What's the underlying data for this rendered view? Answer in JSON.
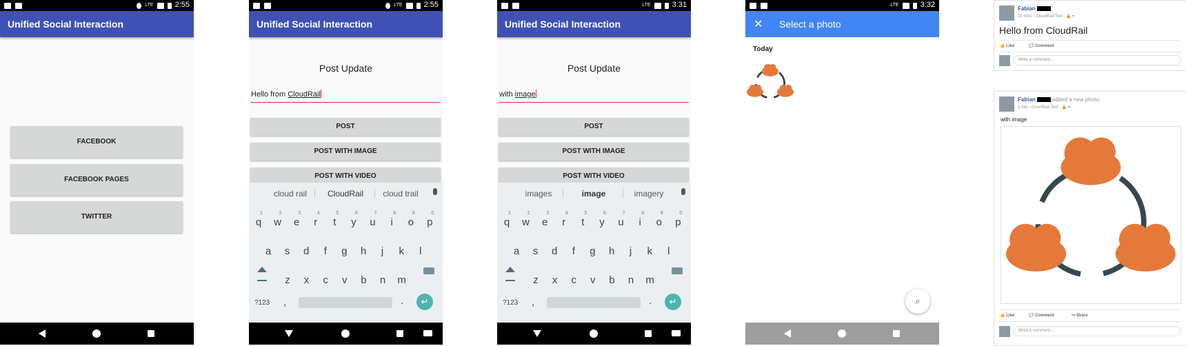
{
  "app_title": "Unified Social Interaction",
  "screen1": {
    "time": "2:55",
    "buttons": [
      "FACEBOOK",
      "FACEBOOK PAGES",
      "TWITTER"
    ]
  },
  "screen2": {
    "time": "2:55",
    "heading": "Post Update",
    "input_prefix": "Hello from ",
    "input_word": "CloudRail",
    "buttons": [
      "POST",
      "POST WITH IMAGE",
      "POST WITH VIDEO"
    ],
    "suggestions": [
      "cloud rail",
      "CloudRail",
      "cloud trail"
    ]
  },
  "screen3": {
    "time": "3:31",
    "heading": "Post Update",
    "input_prefix": "with ",
    "input_word": "image",
    "buttons": [
      "POST",
      "POST WITH IMAGE",
      "POST WITH VIDEO"
    ],
    "suggestions": [
      "images",
      "image",
      "imagery"
    ]
  },
  "keyboard": {
    "row1": [
      "q",
      "w",
      "e",
      "r",
      "t",
      "y",
      "u",
      "i",
      "o",
      "p"
    ],
    "row1_nums": [
      "1",
      "2",
      "3",
      "4",
      "5",
      "6",
      "7",
      "8",
      "9",
      "0"
    ],
    "row2": [
      "a",
      "s",
      "d",
      "f",
      "g",
      "h",
      "j",
      "k",
      "l"
    ],
    "row3": [
      "z",
      "x",
      "c",
      "v",
      "b",
      "n",
      "m"
    ],
    "symbols_key": "?123",
    "comma": ",",
    "period": "."
  },
  "screen4": {
    "time": "3:32",
    "title": "Select a photo",
    "section": "Today",
    "close_icon": "close-icon",
    "zoom_icon": "zoom-icon"
  },
  "facebook": {
    "post1": {
      "name": "Fabian",
      "meta": "10 mins · CloudRail Test · 🔒 ▾",
      "text": "Hello from CloudRail",
      "actions": [
        "Like",
        "Comment"
      ],
      "comment_placeholder": "Write a comment..."
    },
    "post2": {
      "name": "Fabian",
      "added": "added a new photo.",
      "meta": "1 min · CloudRail Test · 🔒 ▾",
      "text": "with image",
      "actions": [
        "Like",
        "Comment",
        "Share"
      ],
      "comment_placeholder": "Write a comment..."
    }
  },
  "colors": {
    "app_bar": "#3f51b5",
    "picker_bar": "#4285f4",
    "cloud_orange": "#e5793a",
    "ring": "#37474f",
    "accent": "#e91e63"
  }
}
